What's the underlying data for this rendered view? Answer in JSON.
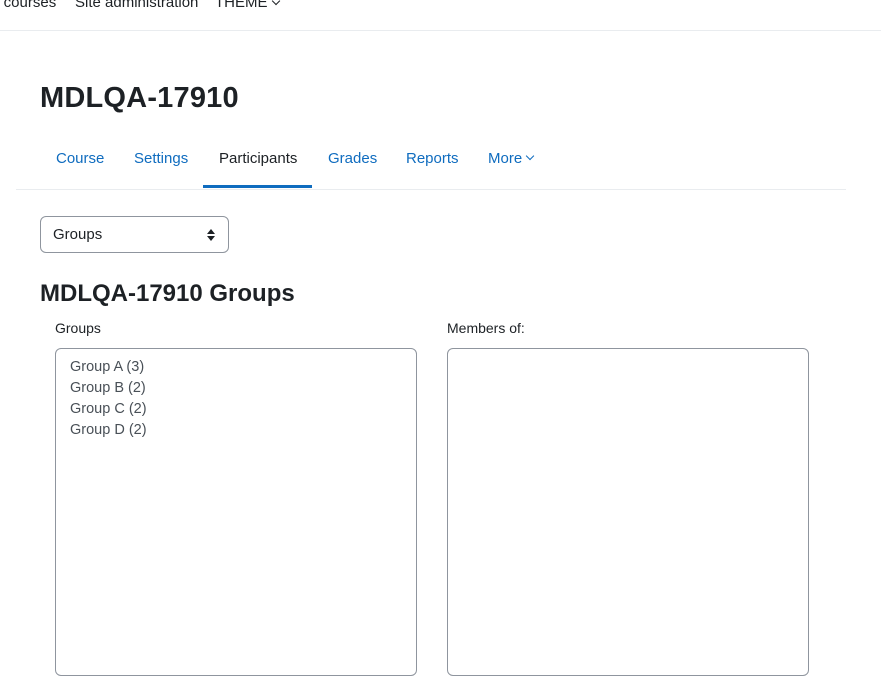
{
  "topnav": {
    "items": [
      "y courses",
      "Site administration",
      "THEME"
    ]
  },
  "page": {
    "title": "MDLQA-17910"
  },
  "secondary_nav": {
    "tabs": [
      {
        "label": "Course",
        "active": false
      },
      {
        "label": "Settings",
        "active": false
      },
      {
        "label": "Participants",
        "active": true
      },
      {
        "label": "Grades",
        "active": false
      },
      {
        "label": "Reports",
        "active": false
      },
      {
        "label": "More",
        "active": false
      }
    ]
  },
  "view_select": {
    "selected": "Groups"
  },
  "groups_page": {
    "heading": "MDLQA-17910 Groups",
    "groups_label": "Groups",
    "members_label": "Members of:",
    "groups": [
      "Group A (3)",
      "Group B (2)",
      "Group C (2)",
      "Group D (2)"
    ],
    "members": []
  },
  "colors": {
    "link": "#0f6cbf",
    "text": "#1d2125",
    "border": "#8f959e",
    "muted_text": "#495057"
  }
}
